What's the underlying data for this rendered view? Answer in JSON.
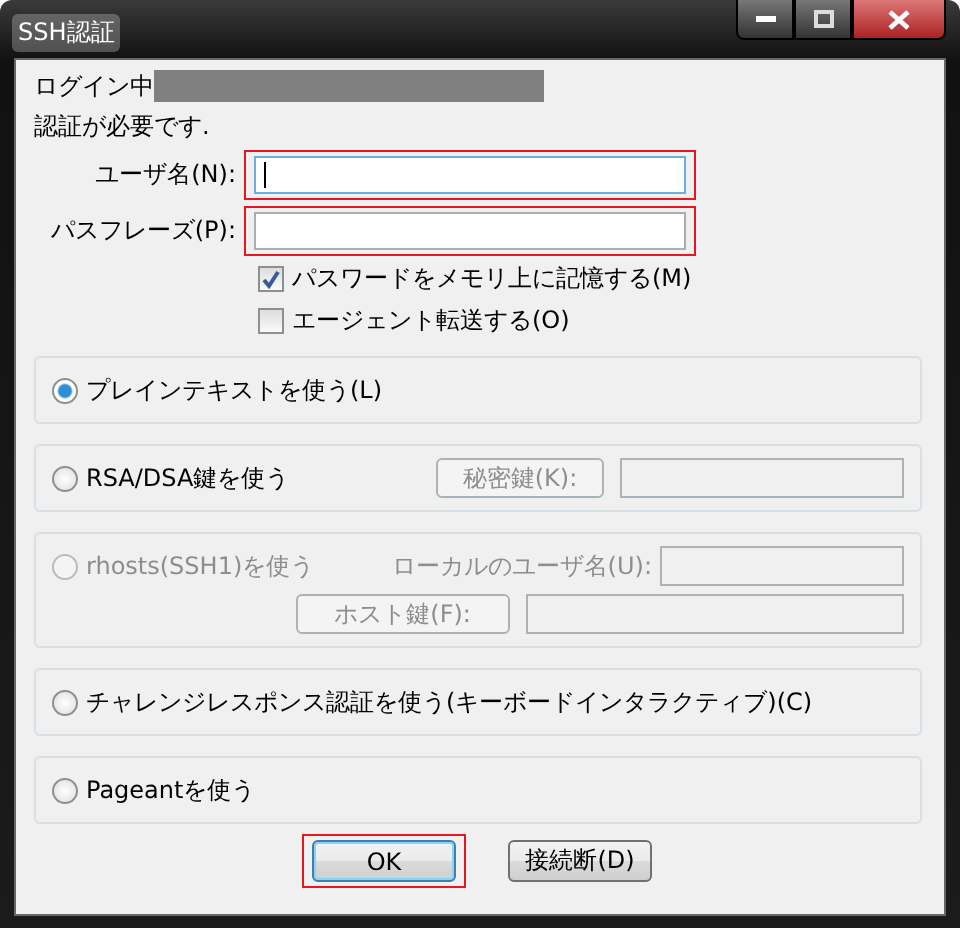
{
  "window": {
    "title": "SSH認証"
  },
  "login_label": "ログイン中",
  "message": "認証が必要です.",
  "fields": [
    {
      "label": "ユーザ名(N):",
      "focused": true,
      "highlighted": true
    },
    {
      "label": "パスフレーズ(P):",
      "focused": false,
      "highlighted": true
    }
  ],
  "checkboxes": [
    {
      "label": "パスワードをメモリ上に記憶する(M)",
      "checked": true
    },
    {
      "label": "エージェント転送する(O)",
      "checked": false
    }
  ],
  "methods": [
    {
      "kind": "plain",
      "label": "プレインテキストを使う(L)",
      "selected": true,
      "disabled": false
    },
    {
      "kind": "key",
      "label": "RSA/DSA鍵を使う",
      "selected": false,
      "disabled": false,
      "button": "秘密鍵(K):",
      "controls_disabled": true
    },
    {
      "kind": "rhosts",
      "label": "rhosts(SSH1)を使う",
      "selected": false,
      "disabled": true,
      "field_label": "ローカルのユーザ名(U):",
      "button": "ホスト鍵(F):",
      "controls_disabled": true
    },
    {
      "kind": "plain",
      "label": "チャレンジレスポンス認証を使う(キーボードインタラクティブ)(C)",
      "selected": false,
      "disabled": false
    },
    {
      "kind": "plain",
      "label": "Pageantを使う",
      "selected": false,
      "disabled": false
    }
  ],
  "buttons": [
    {
      "label": "OK",
      "default": true,
      "highlighted": true
    },
    {
      "label": "接続断(D)",
      "default": false,
      "highlighted": false
    }
  ]
}
